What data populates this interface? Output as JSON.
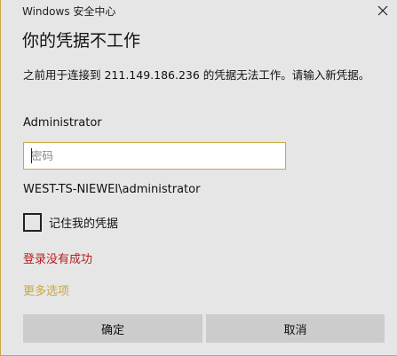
{
  "window": {
    "title": "Windows 安全中心",
    "close_icon": "close-icon"
  },
  "dialog": {
    "heading": "你的凭据不工作",
    "message": "之前用于连接到 211.149.186.236 的凭据无法工作。请输入新凭据。",
    "username": "Administrator",
    "password": {
      "value": "",
      "placeholder": "密码"
    },
    "domain_user": "WEST-TS-NIEWEI\\administrator",
    "remember": {
      "label": "记住我的凭据",
      "checked": false
    },
    "error": "登录没有成功",
    "more_options": "更多选项",
    "ok_label": "确定",
    "cancel_label": "取消"
  },
  "colors": {
    "background": "#e6e6e6",
    "accent": "#c8a840",
    "error": "#b81c1c",
    "button": "#cccccc"
  }
}
